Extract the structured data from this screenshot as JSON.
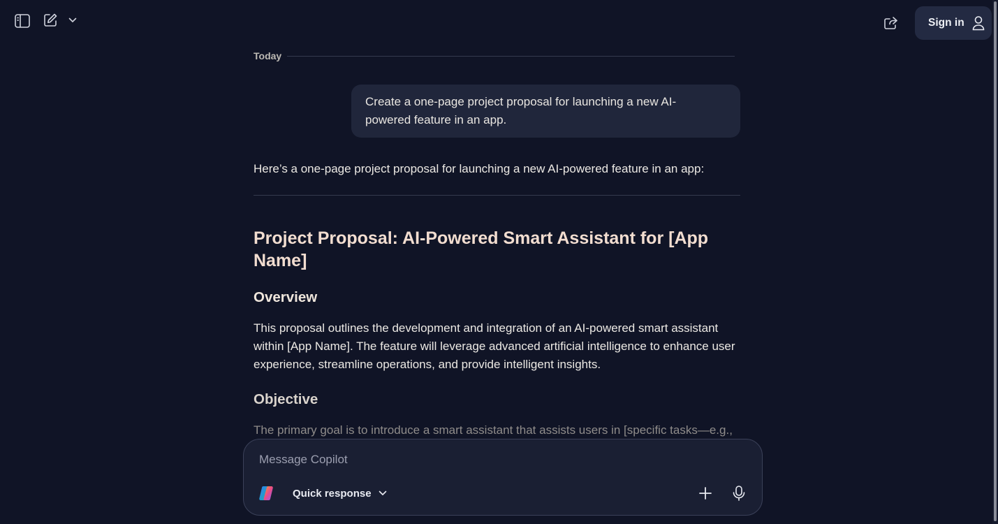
{
  "header": {
    "sidebar_icon": "sidebar-toggle-icon",
    "new_chat_icon": "compose-icon",
    "share_icon": "share-icon",
    "sign_in_label": "Sign in",
    "user_icon": "user-icon"
  },
  "conversation": {
    "date_label": "Today",
    "user_message": "Create a one-page project proposal for launching a new AI-powered feature in an app.",
    "assistant": {
      "intro": "Here’s a one-page project proposal for launching a new AI-powered feature in an app:",
      "title": "Project Proposal: AI-Powered Smart Assistant for [App Name]",
      "sections": [
        {
          "heading": "Overview",
          "body": "This proposal outlines the development and integration of an AI-powered smart assistant within [App Name]. The feature will leverage advanced artificial intelligence to enhance user experience, streamline operations, and provide intelligent insights."
        },
        {
          "heading": "Objective",
          "body": "The primary goal is to introduce a smart assistant that assists users in [specific tasks—e.g.,"
        }
      ]
    }
  },
  "composer": {
    "placeholder": "Message Copilot",
    "mode_label": "Quick response",
    "logo_icon": "copilot-logo-icon",
    "add_icon": "plus-icon",
    "mic_icon": "microphone-icon"
  },
  "colors": {
    "background": "#101426",
    "bubble": "#20263b",
    "title": "#f2ddd0",
    "sign_in_bg": "#232a42"
  }
}
